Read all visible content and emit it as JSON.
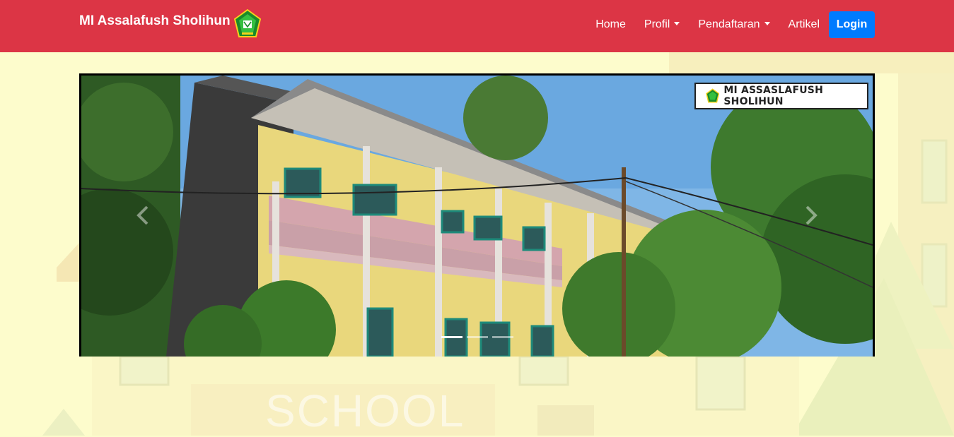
{
  "brand": {
    "name": "MI Assalafush Sholihun"
  },
  "nav": {
    "items": [
      {
        "label": "Home",
        "dropdown": false
      },
      {
        "label": "Profil",
        "dropdown": true
      },
      {
        "label": "Pendaftaran",
        "dropdown": true
      },
      {
        "label": "Artikel",
        "dropdown": false
      }
    ],
    "login_label": "Login"
  },
  "carousel": {
    "watermark_text": "MI ASSASLAFUSH SHOLIHUN",
    "slide_count": 3,
    "active_index": 0
  },
  "background": {
    "sign_text": "SCHOOL"
  },
  "colors": {
    "navbar": "#dc3545",
    "login": "#007bff",
    "page_bg": "#fdfccc"
  }
}
